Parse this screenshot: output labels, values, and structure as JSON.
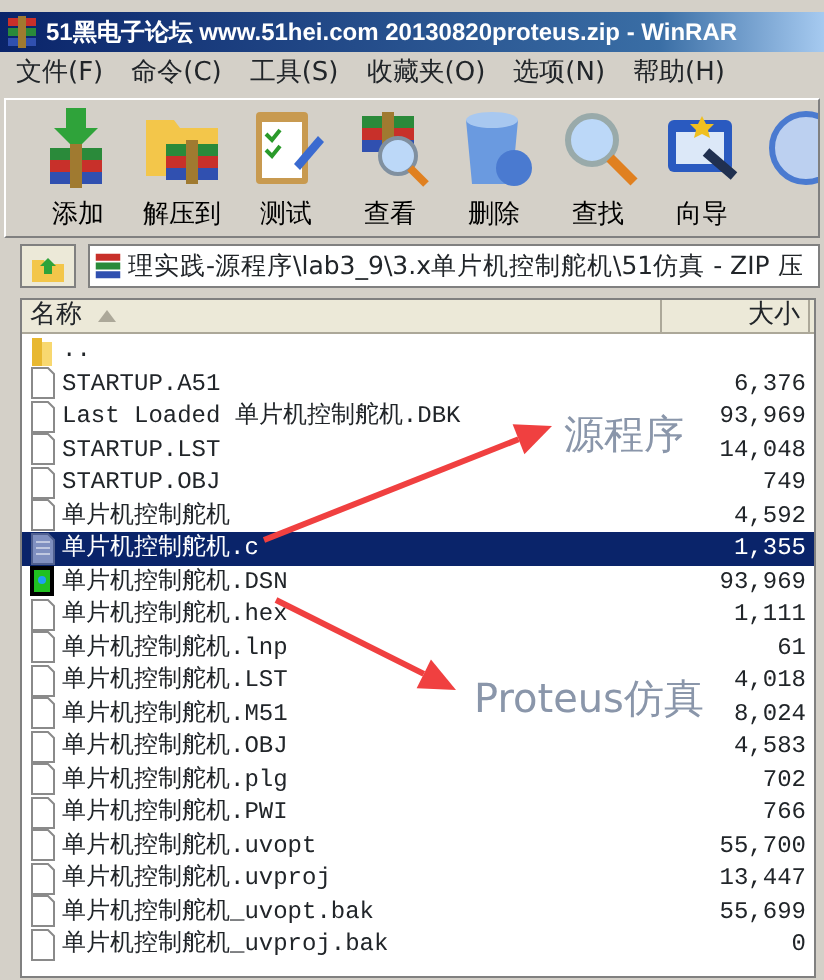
{
  "window": {
    "title": "51黑电子论坛 www.51hei.com 20130820proteus.zip - WinRAR"
  },
  "menu": [
    {
      "label": "文件(F)"
    },
    {
      "label": "命令(C)"
    },
    {
      "label": "工具(S)"
    },
    {
      "label": "收藏夹(O)"
    },
    {
      "label": "选项(N)"
    },
    {
      "label": "帮助(H)"
    }
  ],
  "toolbar": [
    {
      "kind": "add",
      "label": "添加"
    },
    {
      "kind": "extract",
      "label": "解压到"
    },
    {
      "kind": "test",
      "label": "测试"
    },
    {
      "kind": "view",
      "label": "查看"
    },
    {
      "kind": "delete",
      "label": "删除"
    },
    {
      "kind": "find",
      "label": "查找"
    },
    {
      "kind": "wizard",
      "label": "向导"
    },
    {
      "kind": "info"
    }
  ],
  "address": {
    "path": "理实践-源程序\\lab3_9\\3.x单片机控制舵机\\51仿真 - ZIP 压"
  },
  "table": {
    "columns": [
      {
        "label": "名称",
        "sorted": true
      },
      {
        "label": "大小",
        "sorted": false
      }
    ],
    "rows": [
      {
        "kind": "folder",
        "name": "..",
        "size": "",
        "selected": false
      },
      {
        "kind": "file",
        "name": "STARTUP.A51",
        "size": "6,376",
        "selected": false
      },
      {
        "kind": "file",
        "name": "Last Loaded 单片机控制舵机.DBK",
        "size": "93,969",
        "selected": false
      },
      {
        "kind": "file",
        "name": "STARTUP.LST",
        "size": "14,048",
        "selected": false
      },
      {
        "kind": "file",
        "name": "STARTUP.OBJ",
        "size": "749",
        "selected": false
      },
      {
        "kind": "file",
        "name": "单片机控制舵机",
        "size": "4,592",
        "selected": false
      },
      {
        "kind": "source",
        "name": "单片机控制舵机.c",
        "size": "1,355",
        "selected": true
      },
      {
        "kind": "design",
        "name": "单片机控制舵机.DSN",
        "size": "93,969",
        "selected": false
      },
      {
        "kind": "file",
        "name": "单片机控制舵机.hex",
        "size": "1,111",
        "selected": false
      },
      {
        "kind": "file",
        "name": "单片机控制舵机.lnp",
        "size": "61",
        "selected": false
      },
      {
        "kind": "file",
        "name": "单片机控制舵机.LST",
        "size": "4,018",
        "selected": false
      },
      {
        "kind": "file",
        "name": "单片机控制舵机.M51",
        "size": "8,024",
        "selected": false
      },
      {
        "kind": "file",
        "name": "单片机控制舵机.OBJ",
        "size": "4,583",
        "selected": false
      },
      {
        "kind": "file",
        "name": "单片机控制舵机.plg",
        "size": "702",
        "selected": false
      },
      {
        "kind": "file",
        "name": "单片机控制舵机.PWI",
        "size": "766",
        "selected": false
      },
      {
        "kind": "file",
        "name": "单片机控制舵机.uvopt",
        "size": "55,700",
        "selected": false
      },
      {
        "kind": "file",
        "name": "单片机控制舵机.uvproj",
        "size": "13,447",
        "selected": false
      },
      {
        "kind": "file",
        "name": "单片机控制舵机_uvopt.bak",
        "size": "55,699",
        "selected": false
      },
      {
        "kind": "file",
        "name": "单片机控制舵机_uvproj.bak",
        "size": "0",
        "selected": false
      }
    ]
  },
  "annotations": [
    {
      "text": "源程序"
    },
    {
      "text": "Proteus仿真"
    }
  ]
}
